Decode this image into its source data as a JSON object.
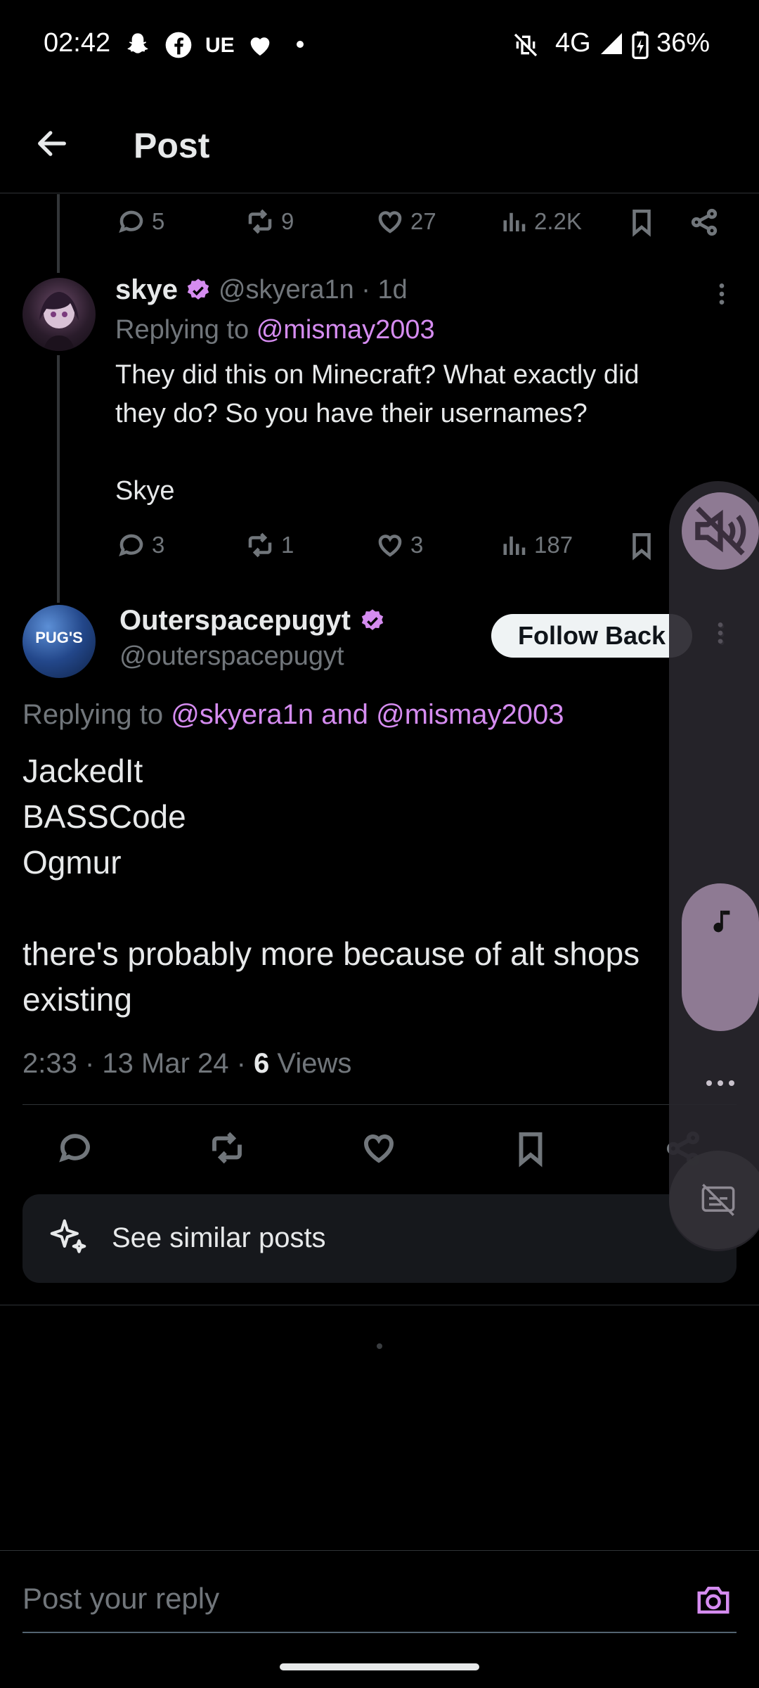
{
  "status_bar": {
    "time": "02:42",
    "notif_text": "UE",
    "network": "4G",
    "battery": "36%"
  },
  "header": {
    "title": "Post"
  },
  "first_post_actions": {
    "replies": "5",
    "reposts": "9",
    "likes": "27",
    "views": "2.2K"
  },
  "reply_post": {
    "name": "skye",
    "handle": "@skyera1n · 1d",
    "replying_prefix": "Replying to",
    "replying_to": "@mismay2003",
    "text_line1": "They did this on Minecraft? What exactly did",
    "text_line2": "they do? So you have their usernames?",
    "text_line3": "Skye",
    "replies": "3",
    "reposts": "1",
    "likes": "3",
    "views": "187"
  },
  "main_post": {
    "name": "Outerspacepugyt",
    "handle": "@outerspacepugyt",
    "avatar_text": "PUG'S",
    "follow_label": "Follow Back",
    "replying_prefix": "Replying to",
    "replying_to": "@skyera1n and @mismay2003",
    "lines": [
      "JackedIt",
      "BASSCode",
      "Ogmur",
      "there's probably more because of alt shops",
      "existing"
    ],
    "timestamp": "2:33 · 13 Mar 24 · ",
    "views_count": "6",
    "views_label": "Views"
  },
  "similar": {
    "label": "See similar posts"
  },
  "reply_bar": {
    "placeholder": "Post your reply"
  },
  "colors": {
    "accent": "#d58cf0",
    "background": "#000000",
    "muted": "#71767b"
  }
}
